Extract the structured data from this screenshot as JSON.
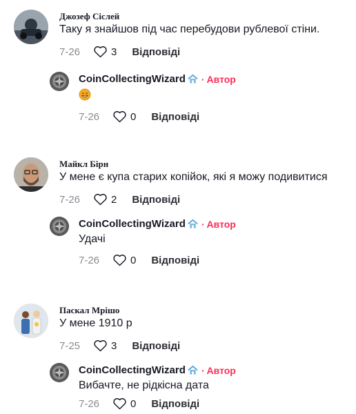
{
  "threads": [
    {
      "comment": {
        "author": "Джозеф Сіслей",
        "text": "Таку я знайшов під час перебудови рублевої стіни.",
        "date": "7-26",
        "likes": "3",
        "reply_label": "Відповіді"
      },
      "reply": {
        "author": "CoinCollectingWizard",
        "badge_icon": "house-icon",
        "separator": "·",
        "author_tag": "Автор",
        "text": "",
        "emoji_icon": "sweat-smile-emoji",
        "date": "7-26",
        "likes": "0",
        "reply_label": "Відповіді"
      }
    },
    {
      "comment": {
        "author": "Майкл Бірн",
        "text": "У мене є купа старих копійок, які я можу подивитися",
        "date": "7-26",
        "likes": "2",
        "reply_label": "Відповіді"
      },
      "reply": {
        "author": "CoinCollectingWizard",
        "badge_icon": "house-icon",
        "separator": "·",
        "author_tag": "Автор",
        "text": "Удачі",
        "date": "7-26",
        "likes": "0",
        "reply_label": "Відповіді"
      }
    },
    {
      "comment": {
        "author": "Паскал Мрішо",
        "text": "У мене 1910 р",
        "date": "7-25",
        "likes": "3",
        "reply_label": "Відповіді"
      },
      "reply": {
        "author": "CoinCollectingWizard",
        "badge_icon": "house-icon",
        "separator": "·",
        "author_tag": "Автор",
        "text": "Вибачте, не рідкісна дата",
        "date": "7-26",
        "likes": "0",
        "reply_label": "Відповіді"
      }
    }
  ],
  "colors": {
    "author_tag": "#fe2c55",
    "muted": "#8a8b91",
    "text": "#161823"
  }
}
